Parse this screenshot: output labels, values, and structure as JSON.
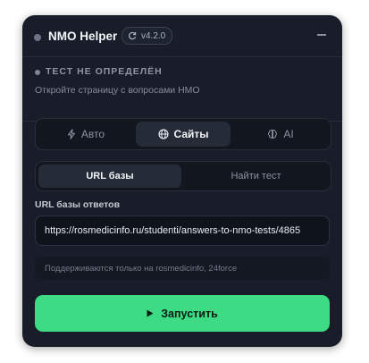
{
  "header": {
    "title": "NMO Helper",
    "version": "v4.2.0"
  },
  "status": {
    "title": "ТЕСТ НЕ ОПРЕДЕЛЁН",
    "subtitle": "Откройте страницу с вопросами НМО"
  },
  "mode_tabs": [
    {
      "label": "Авто",
      "icon": "lightning-icon"
    },
    {
      "label": "Сайты",
      "icon": "globe-icon",
      "active": true
    },
    {
      "label": "AI",
      "icon": "brain-icon"
    }
  ],
  "source_tabs": [
    {
      "label": "URL базы",
      "active": true
    },
    {
      "label": "Найти тест"
    }
  ],
  "url_field": {
    "label": "URL базы ответов",
    "value": "https://rosmedicinfo.ru/studenti/answers-to-nmo-tests/4865"
  },
  "hint": "Поддерживаются только на rosmedicinfo, 24force",
  "run_button": {
    "label": "Запустить",
    "icon": "play-icon"
  },
  "colors": {
    "panel": "#181d29",
    "accent": "#3ddc84",
    "active_tab": "#262b38"
  }
}
